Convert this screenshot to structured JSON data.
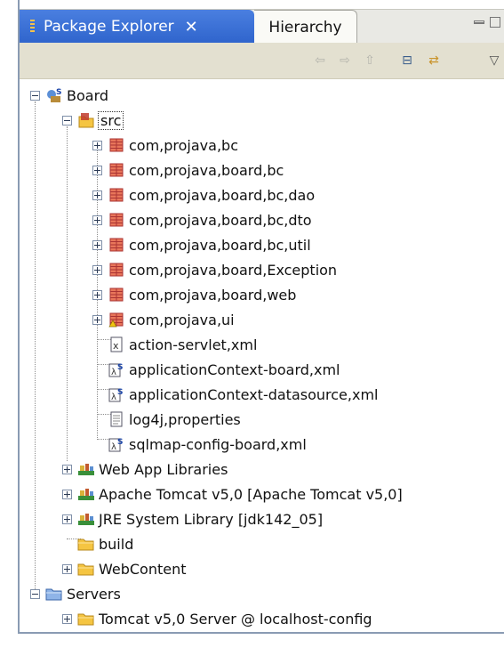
{
  "tabs": {
    "active_label": "Package Explorer",
    "active_close": "✕",
    "inactive_label": "Hierarchy"
  },
  "toolbar": {
    "back_icon": "⇦",
    "forward_icon": "⇨",
    "up_icon": "⇧",
    "collapse_icon": "⊟",
    "link_icon": "⇄",
    "menu_icon": "▽"
  },
  "tree": {
    "board": "Board",
    "src": "src",
    "packages": [
      "com,projava,bc",
      "com,projava,board,bc",
      "com,projava,board,bc,dao",
      "com,projava,board,bc,dto",
      "com,projava,board,bc,util",
      "com,projava,board,Exception",
      "com,projava,board,web",
      "com,projava,ui"
    ],
    "files": [
      "action-servlet,xml",
      "applicationContext-board,xml",
      "applicationContext-datasource,xml",
      "log4j,properties",
      "sqlmap-config-board,xml"
    ],
    "web_app_libraries": "Web App Libraries",
    "tomcat_lib": "Apache Tomcat v5,0 [Apache Tomcat v5,0]",
    "jre_lib": "JRE System Library [jdk142_05]",
    "build": "build",
    "webcontent": "WebContent",
    "servers": "Servers",
    "tomcat_server": "Tomcat v5,0 Server @ localhost-config"
  },
  "colors": {
    "tab_active": "#3a70d8",
    "package_icon": "#c0392b",
    "folder": "#f5c542"
  }
}
